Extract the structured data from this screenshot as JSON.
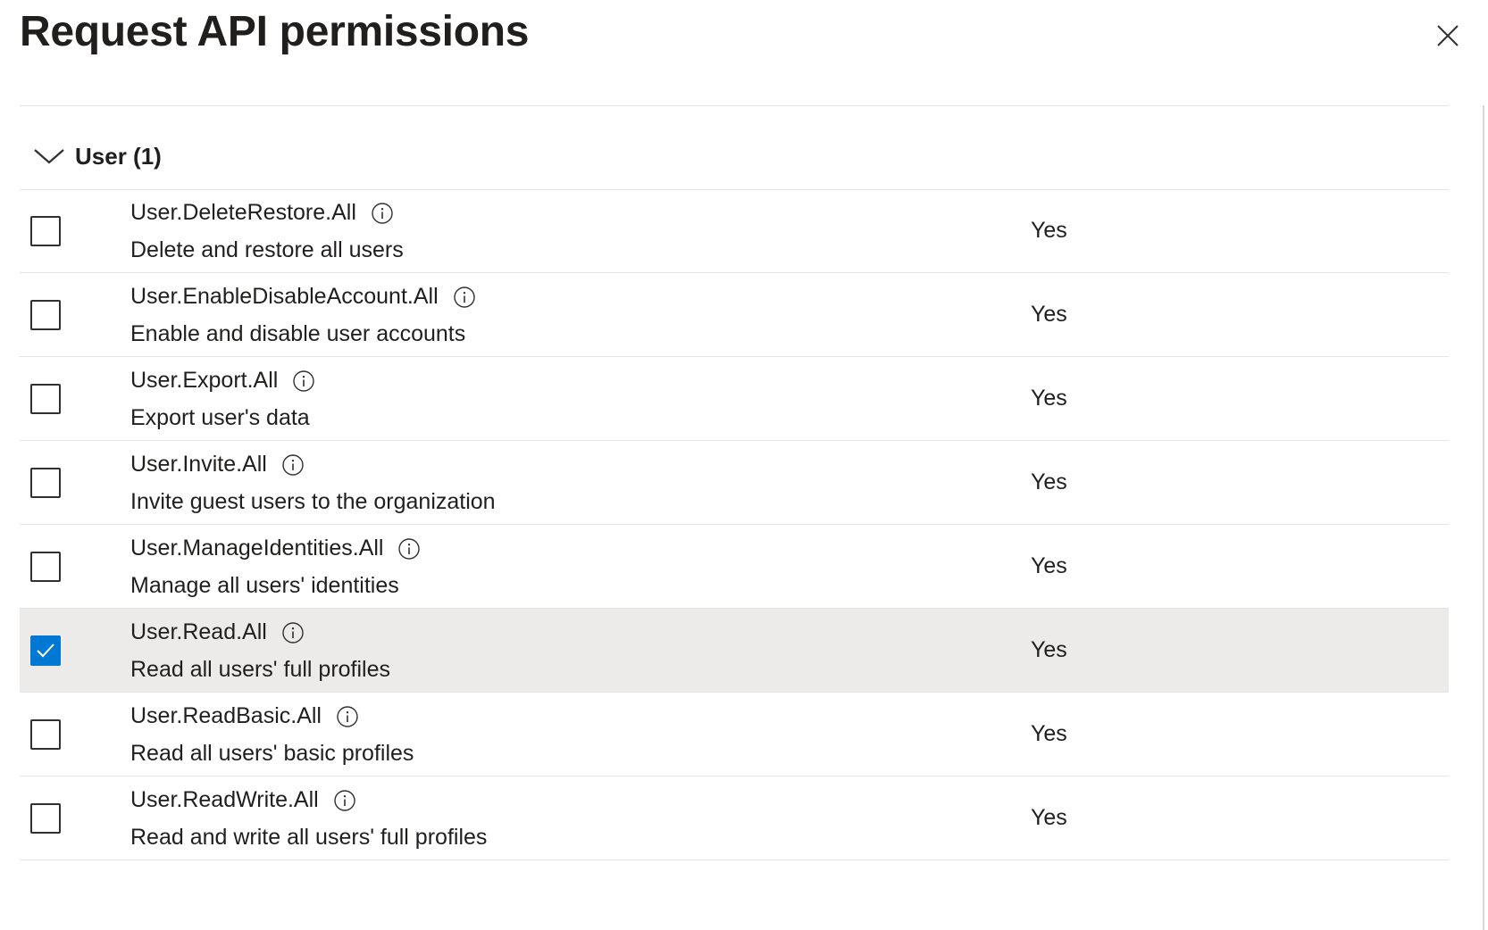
{
  "dialog": {
    "title": "Request API permissions"
  },
  "group": {
    "label": "User (1)",
    "expanded": true
  },
  "permissions": [
    {
      "name": "User.DeleteRestore.All",
      "description": "Delete and restore all users",
      "admin_consent": "Yes",
      "checked": false
    },
    {
      "name": "User.EnableDisableAccount.All",
      "description": "Enable and disable user accounts",
      "admin_consent": "Yes",
      "checked": false
    },
    {
      "name": "User.Export.All",
      "description": "Export user's data",
      "admin_consent": "Yes",
      "checked": false
    },
    {
      "name": "User.Invite.All",
      "description": "Invite guest users to the organization",
      "admin_consent": "Yes",
      "checked": false
    },
    {
      "name": "User.ManageIdentities.All",
      "description": "Manage all users' identities",
      "admin_consent": "Yes",
      "checked": false
    },
    {
      "name": "User.Read.All",
      "description": "Read all users' full profiles",
      "admin_consent": "Yes",
      "checked": true
    },
    {
      "name": "User.ReadBasic.All",
      "description": "Read all users' basic profiles",
      "admin_consent": "Yes",
      "checked": false
    },
    {
      "name": "User.ReadWrite.All",
      "description": "Read and write all users' full profiles",
      "admin_consent": "Yes",
      "checked": false
    }
  ],
  "icons": {
    "close": "close-icon",
    "chevron": "chevron-down-icon",
    "info": "info-icon",
    "check": "checkmark-icon"
  },
  "colors": {
    "accent": "#0078d4",
    "selected_row": "#edebe9",
    "text": "#201f1e"
  }
}
